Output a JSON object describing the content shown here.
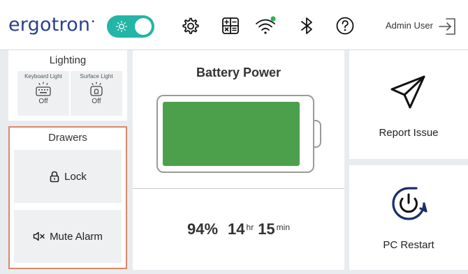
{
  "header": {
    "logo_text": "ergotron",
    "logo_mark": "•",
    "theme_toggle_state": "on",
    "icons": [
      "settings-gear-icon",
      "calculator-icon",
      "wifi-icon",
      "bluetooth-icon",
      "help-icon"
    ],
    "wifi_status_color": "#2fb34a",
    "user_name": "Admin User",
    "logout_icon": "logout-icon"
  },
  "lighting": {
    "title": "Lighting",
    "keyboard": {
      "label": "Keyboard Light",
      "state": "Off"
    },
    "surface": {
      "label": "Surface Light",
      "state": "Off"
    }
  },
  "drawers": {
    "title": "Drawers",
    "lock_label": "Lock",
    "mute_label": "Mute Alarm"
  },
  "battery": {
    "title": "Battery Power",
    "percent_value": 94,
    "percent_text": "94%",
    "hours": "14",
    "hours_unit": "hr",
    "minutes": "15",
    "minutes_unit": "min",
    "fill_color": "#4ca04c"
  },
  "actions": {
    "report_label": "Report Issue",
    "restart_label": "PC Restart"
  },
  "colors": {
    "accent_teal": "#23b5a6",
    "brand_blue": "#2a3f8c",
    "highlight_border": "#d9886a"
  }
}
